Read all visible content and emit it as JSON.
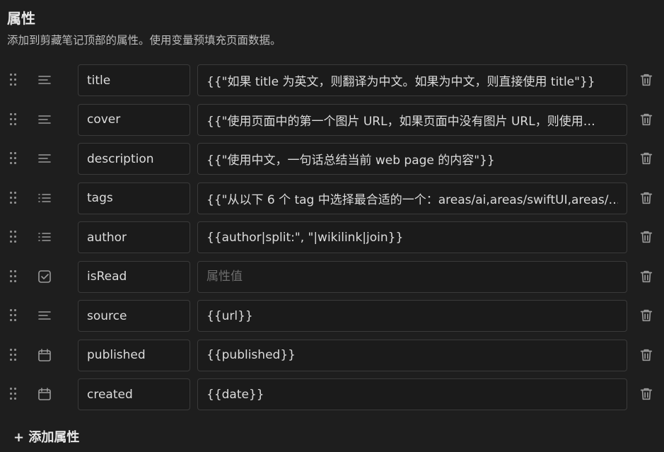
{
  "section": {
    "title": "属性",
    "description": "添加到剪藏笔记顶部的属性。使用变量预填充页面数据。"
  },
  "properties": [
    {
      "type_icon": "text-lines-icon",
      "name": "title",
      "value": "{{\"如果 title 为英文，则翻译为中文。如果为中文，则直接使用 title\"}}"
    },
    {
      "type_icon": "text-lines-icon",
      "name": "cover",
      "value": "{{\"使用页面中的第一个图片 URL，如果页面中没有图片 URL，则使用…"
    },
    {
      "type_icon": "text-lines-icon",
      "name": "description",
      "value": "{{\"使用中文，一句话总结当前 web page 的内容\"}}"
    },
    {
      "type_icon": "list-icon",
      "name": "tags",
      "value": "{{\"从以下 6 个 tag 中选择最合适的一个：areas/ai,areas/swiftUI,areas/…"
    },
    {
      "type_icon": "list-icon",
      "name": "author",
      "value": "{{author|split:\", \"|wikilink|join}}"
    },
    {
      "type_icon": "checkbox-icon",
      "name": "isRead",
      "value": "",
      "placeholder": "属性值"
    },
    {
      "type_icon": "text-lines-icon",
      "name": "source",
      "value": "{{url}}"
    },
    {
      "type_icon": "calendar-icon",
      "name": "published",
      "value": "{{published}}"
    },
    {
      "type_icon": "calendar-icon",
      "name": "created",
      "value": "{{date}}"
    }
  ],
  "add_button_label": "+ 添加属性",
  "colors": {
    "background": "#1e1e1e",
    "field_border": "#3a3a3a",
    "text": "#dcdcdc"
  }
}
